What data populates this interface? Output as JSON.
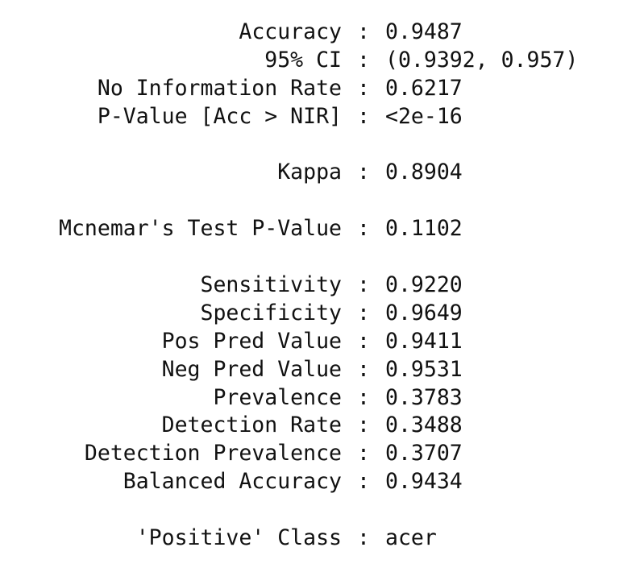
{
  "stats": {
    "separator": ":",
    "rows": [
      {
        "label": "Accuracy",
        "value": "0.9487"
      },
      {
        "label": "95% CI",
        "value": "(0.9392, 0.957)"
      },
      {
        "label": "No Information Rate",
        "value": "0.6217"
      },
      {
        "label": "P-Value [Acc > NIR]",
        "value": "<2e-16"
      },
      {
        "label": "Kappa",
        "value": "0.8904"
      },
      {
        "label": "Mcnemar's Test P-Value",
        "value": "0.1102"
      },
      {
        "label": "Sensitivity",
        "value": "0.9220"
      },
      {
        "label": "Specificity",
        "value": "0.9649"
      },
      {
        "label": "Pos Pred Value",
        "value": "0.9411"
      },
      {
        "label": "Neg Pred Value",
        "value": "0.9531"
      },
      {
        "label": "Prevalence",
        "value": "0.3783"
      },
      {
        "label": "Detection Rate",
        "value": "0.3488"
      },
      {
        "label": "Detection Prevalence",
        "value": "0.3707"
      },
      {
        "label": "Balanced Accuracy",
        "value": "0.9434"
      },
      {
        "label": "'Positive' Class",
        "value": "acer"
      }
    ]
  }
}
